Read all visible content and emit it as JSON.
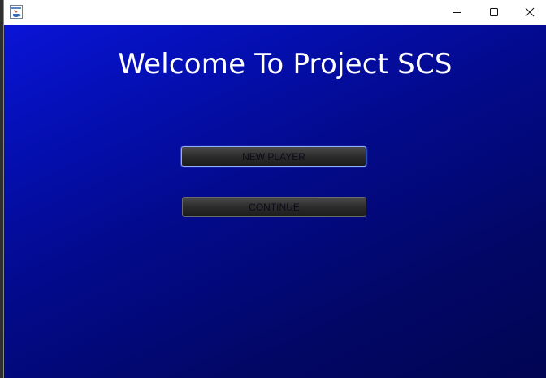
{
  "window": {
    "icon": "java-cup-icon",
    "controls": {
      "minimize": "minimize-icon",
      "maximize": "maximize-icon",
      "close": "close-icon"
    }
  },
  "screen": {
    "title": "Welcome To Project SCS",
    "buttons": {
      "new_player": "NEW PLAYER",
      "continue": "CONTINUE"
    }
  },
  "colors": {
    "background_top": "#0a14d6",
    "background_bottom": "#010552",
    "title_text": "#ffffff",
    "button_face": "#2c2c2c",
    "focus_ring": "#8fb0ff"
  }
}
